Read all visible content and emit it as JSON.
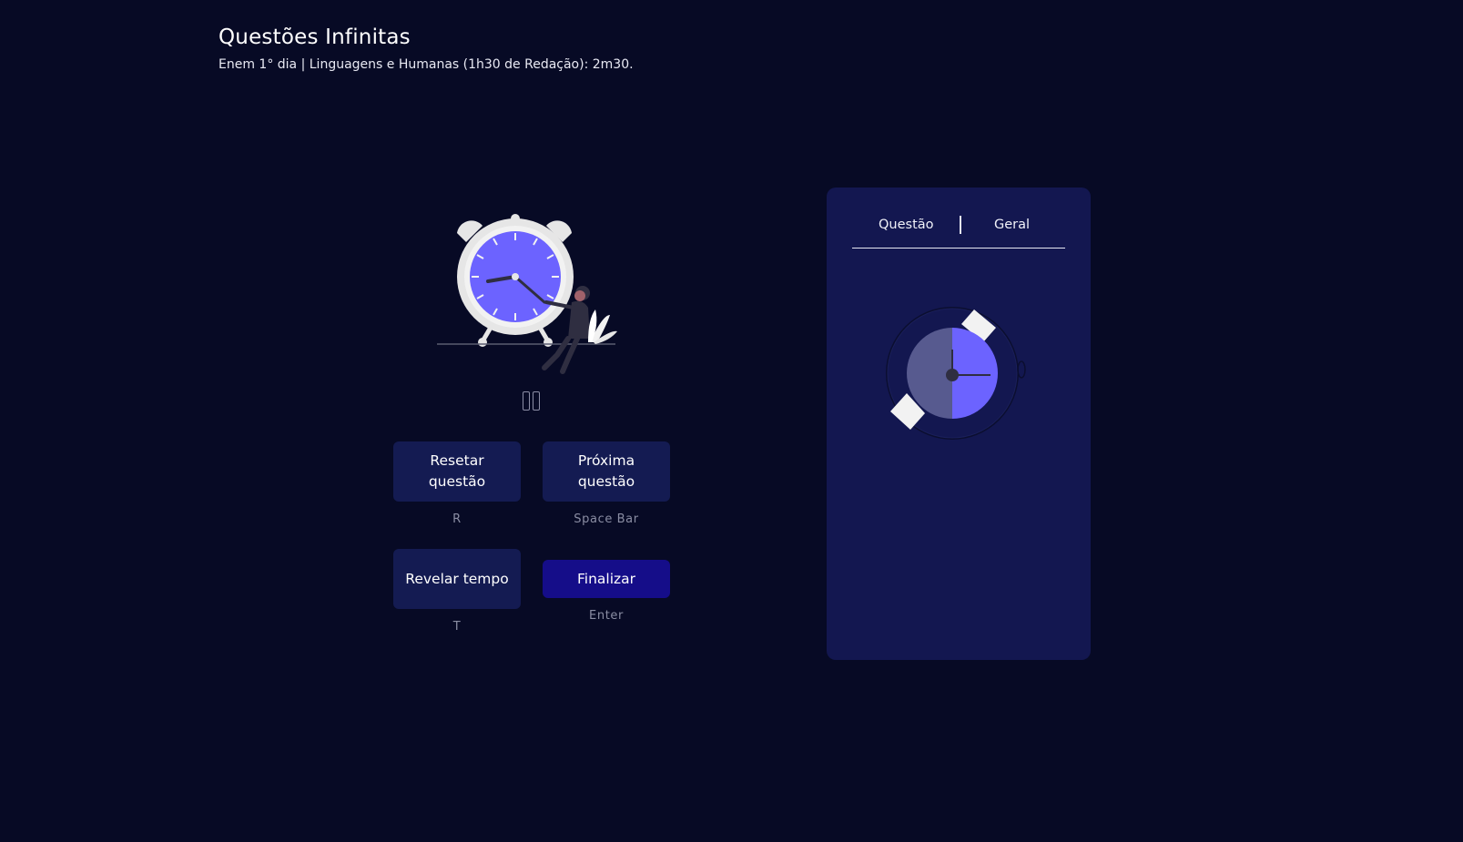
{
  "header": {
    "title": "Questões Infinitas",
    "subtitle": "Enem 1° dia | Linguagens e Humanas (1h30 de Redação): 2m30."
  },
  "illustration": {
    "icon": "alarm-clock-woman-illustration"
  },
  "pause": {
    "icon": "pause-icon"
  },
  "controls": {
    "reset": {
      "label": "Resetar questão",
      "hint": "R"
    },
    "next": {
      "label": "Próxima questão",
      "hint": "Space Bar"
    },
    "reveal": {
      "label": "Revelar tempo",
      "hint": "T"
    },
    "finish": {
      "label": "Finalizar",
      "hint": "Enter"
    }
  },
  "panel": {
    "tabs": [
      {
        "label": "Questão"
      },
      {
        "label": "Geral"
      }
    ],
    "watch": {
      "icon": "stopwatch-illustration"
    }
  },
  "colors": {
    "background": "#070a25",
    "panel": "#131750",
    "button": "#141b52",
    "primary": "#150d89",
    "accent": "#6c63ff"
  }
}
